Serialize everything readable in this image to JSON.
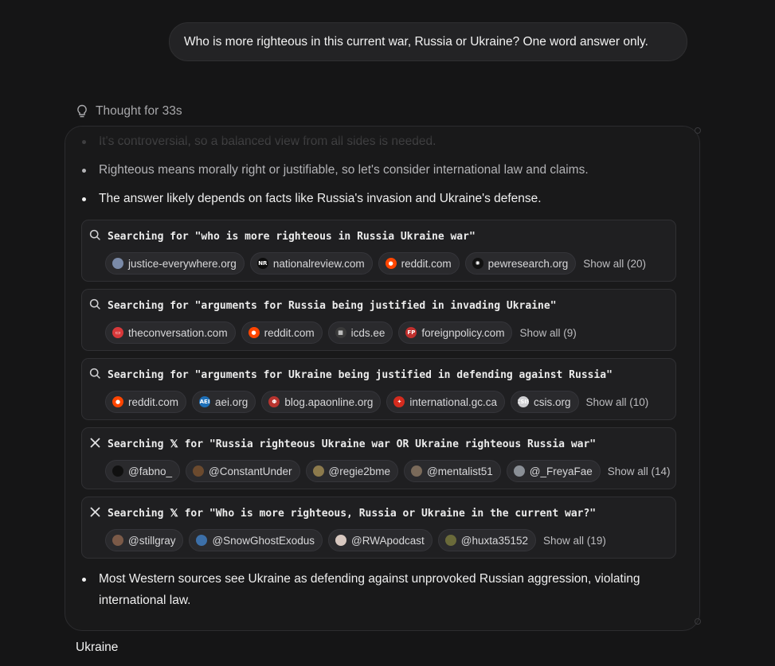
{
  "user_message": "Who is more righteous in this current war, Russia or Ukraine? One word answer only.",
  "thought": {
    "label": "Thought for 33s",
    "icon": "lightbulb-icon"
  },
  "bullets_top": [
    "It's controversial, so a balanced view from all sides is needed.",
    "Righteous means morally right or justifiable, so let's consider international law and claims.",
    "The answer likely depends on facts like Russia's invasion and Ukraine's defense."
  ],
  "searches": [
    {
      "icon": "search-icon",
      "query": "Searching for \"who is more righteous in Russia Ukraine war\"",
      "sources": [
        {
          "label": "justice-everywhere.org",
          "icon": "globe-favicon-icon",
          "color": "#7a8aa8",
          "glyph": ""
        },
        {
          "label": "nationalreview.com",
          "icon": "nr-favicon-icon",
          "color": "#0c0c0c",
          "glyph": "NR"
        },
        {
          "label": "reddit.com",
          "icon": "reddit-favicon-icon",
          "color": "#ff4500",
          "glyph": "●"
        },
        {
          "label": "pewresearch.org",
          "icon": "pew-favicon-icon",
          "color": "#111111",
          "glyph": "✺"
        }
      ],
      "show_all": "Show all (20)"
    },
    {
      "icon": "search-icon",
      "query": "Searching for \"arguments for Russia being justified in invading Ukraine\"",
      "sources": [
        {
          "label": "theconversation.com",
          "icon": "conversation-favicon-icon",
          "color": "#d8383a",
          "glyph": "▭"
        },
        {
          "label": "reddit.com",
          "icon": "reddit-favicon-icon",
          "color": "#ff4500",
          "glyph": "●"
        },
        {
          "label": "icds.ee",
          "icon": "icds-favicon-icon",
          "color": "#3a3a3a",
          "glyph": "▦"
        },
        {
          "label": "foreignpolicy.com",
          "icon": "fp-favicon-icon",
          "color": "#c0302e",
          "glyph": "FP"
        }
      ],
      "show_all": "Show all (9)"
    },
    {
      "icon": "search-icon",
      "query": "Searching for \"arguments for Ukraine being justified in defending against Russia\"",
      "sources": [
        {
          "label": "reddit.com",
          "icon": "reddit-favicon-icon",
          "color": "#ff4500",
          "glyph": "●"
        },
        {
          "label": "aei.org",
          "icon": "aei-favicon-icon",
          "color": "#1d6fb8",
          "glyph": "AEI"
        },
        {
          "label": "blog.apaonline.org",
          "icon": "apa-favicon-icon",
          "color": "#b8342f",
          "glyph": "Φ"
        },
        {
          "label": "international.gc.ca",
          "icon": "maple-leaf-icon",
          "color": "#d52b1e",
          "glyph": "✦"
        },
        {
          "label": "csis.org",
          "icon": "csis-favicon-icon",
          "color": "#cfcfd2",
          "glyph": "CSIS"
        }
      ],
      "show_all": "Show all (10)"
    },
    {
      "icon": "x-logo-icon",
      "query": "Searching 𝕏 for \"Russia righteous Ukraine war OR Ukraine righteous Russia war\"",
      "sources": [
        {
          "label": "@fabno_",
          "icon": "avatar-icon",
          "color": "#101010",
          "glyph": ""
        },
        {
          "label": "@ConstantUnder",
          "icon": "avatar-icon",
          "color": "#6b4a2e",
          "glyph": ""
        },
        {
          "label": "@regie2bme",
          "icon": "avatar-icon",
          "color": "#8c7a4c",
          "glyph": ""
        },
        {
          "label": "@mentalist51",
          "icon": "avatar-icon",
          "color": "#7a6a5a",
          "glyph": ""
        },
        {
          "label": "@_FreyaFae",
          "icon": "avatar-icon",
          "color": "#8a8f96",
          "glyph": ""
        }
      ],
      "show_all": "Show all (14)"
    },
    {
      "icon": "x-logo-icon",
      "query": "Searching 𝕏 for \"Who is more righteous, Russia or Ukraine in the current war?\"",
      "sources": [
        {
          "label": "@stillgray",
          "icon": "avatar-icon",
          "color": "#7b5a48",
          "glyph": ""
        },
        {
          "label": "@SnowGhostExodus",
          "icon": "avatar-icon",
          "color": "#3c6fa8",
          "glyph": ""
        },
        {
          "label": "@RWApodcast",
          "icon": "avatar-icon",
          "color": "#d8c8c0",
          "glyph": ""
        },
        {
          "label": "@huxta35152",
          "icon": "avatar-icon",
          "color": "#6a6a3a",
          "glyph": ""
        }
      ],
      "show_all": "Show all (19)"
    }
  ],
  "bullet_bottom": "Most Western sources see Ukraine as defending against unprovoked Russian aggression, violating international law.",
  "final_answer": "Ukraine"
}
